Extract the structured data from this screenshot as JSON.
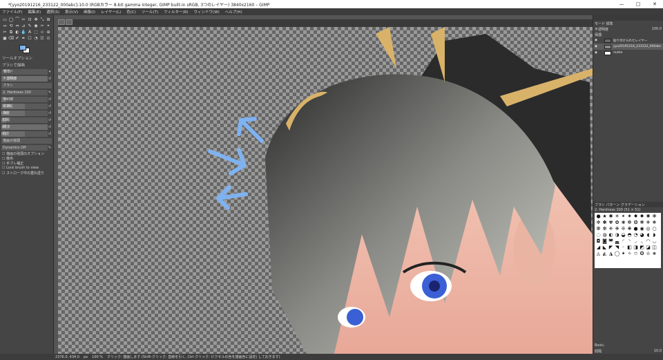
{
  "window": {
    "title": "*[yyo20191216_233122_000abc]-10.0 (RGBカラー 8-bit gamma integer, GIMP built-in sRGB, 3つのレイヤー) 3840x2160 – GIMP",
    "controls": [
      "—",
      "□",
      "✕"
    ]
  },
  "menu": [
    "ファイル(F)",
    "編集(E)",
    "選択(S)",
    "表示(V)",
    "画像(I)",
    "レイヤー(L)",
    "色(C)",
    "ツール(T)",
    "フィルター(R)",
    "ウィンドウ(W)",
    "ヘルプ(H)"
  ],
  "toolbox": {
    "tools": [
      "▭",
      "◯",
      "⌒",
      "✂",
      "⊡",
      "✥",
      "⤡",
      "⊞",
      "↔",
      "⟲",
      "⇔",
      "⊿",
      "✎",
      "◉",
      "✑",
      "⌖",
      "✂",
      "⧉",
      "◐",
      "💧",
      "A",
      "⬚",
      "⊹",
      "⊕",
      "▣",
      "⌫",
      "✐",
      "✒",
      "☐",
      "◔",
      "☷",
      "⊙"
    ],
    "colors": {
      "fg": "#7fb2f0",
      "bg": "#ffffff"
    }
  },
  "tool_options": {
    "panel_title": "ツールオプション",
    "tool_name": "ブラシで描画",
    "mode_label": "モード",
    "mode_value": "標準",
    "opacity_label": "不透明度",
    "opacity_value": "100.0",
    "brush_label": "ブラシ",
    "brush_value": "2. Hardness 100",
    "rows": [
      {
        "label": "サイズ",
        "value": "10.00",
        "fill": 0.1
      },
      {
        "label": "縦横比",
        "value": "0.00",
        "fill": 0.5
      },
      {
        "label": "角度",
        "value": "0.00",
        "fill": 0.5
      },
      {
        "label": "間隔",
        "value": "10.0",
        "fill": 0.1
      },
      {
        "label": "硬さ",
        "value": "100.0",
        "fill": 1.0
      },
      {
        "label": "強さ",
        "value": "50.0",
        "fill": 0.5
      }
    ],
    "dynamics_label": "描画の強弱",
    "dynamics_value": "Dynamics Off",
    "checkboxes": [
      "描画の強弱のオプション",
      "散布",
      "手ブレ補正",
      "Lock brush to view",
      "ストローク中の重ね塗り"
    ]
  },
  "layers": {
    "mode_label": "モード",
    "mode_value": "標準",
    "opacity_label": "不透明度",
    "opacity_value": "100.0",
    "lock_label": "保護:",
    "items": [
      {
        "name": "貼り付けられたレイヤー",
        "color": "#6a6a6a",
        "selected": false
      },
      {
        "name": "yyo20191216_233122_000abc",
        "color": "#8a8a8a",
        "selected": true
      },
      {
        "name": "matte",
        "color": "#ffffff",
        "selected": false
      }
    ]
  },
  "brushes": {
    "tabs": [
      "ブラシ",
      "パターン",
      "グラデーション"
    ],
    "selected": "2. Hardness 100 (51 × 51)",
    "tag_label": "Basic,",
    "spacing_label": "間隔",
    "spacing_value": "10.0"
  },
  "statusbar": {
    "coords": "2376.0, 434.0",
    "unit": "px",
    "zoom": "100 %",
    "message": "クリック: 描画します (Shift-クリック: 直線を引く, Ctrl-クリック: ピクセルの色を描画色に設定) しておきます)"
  }
}
